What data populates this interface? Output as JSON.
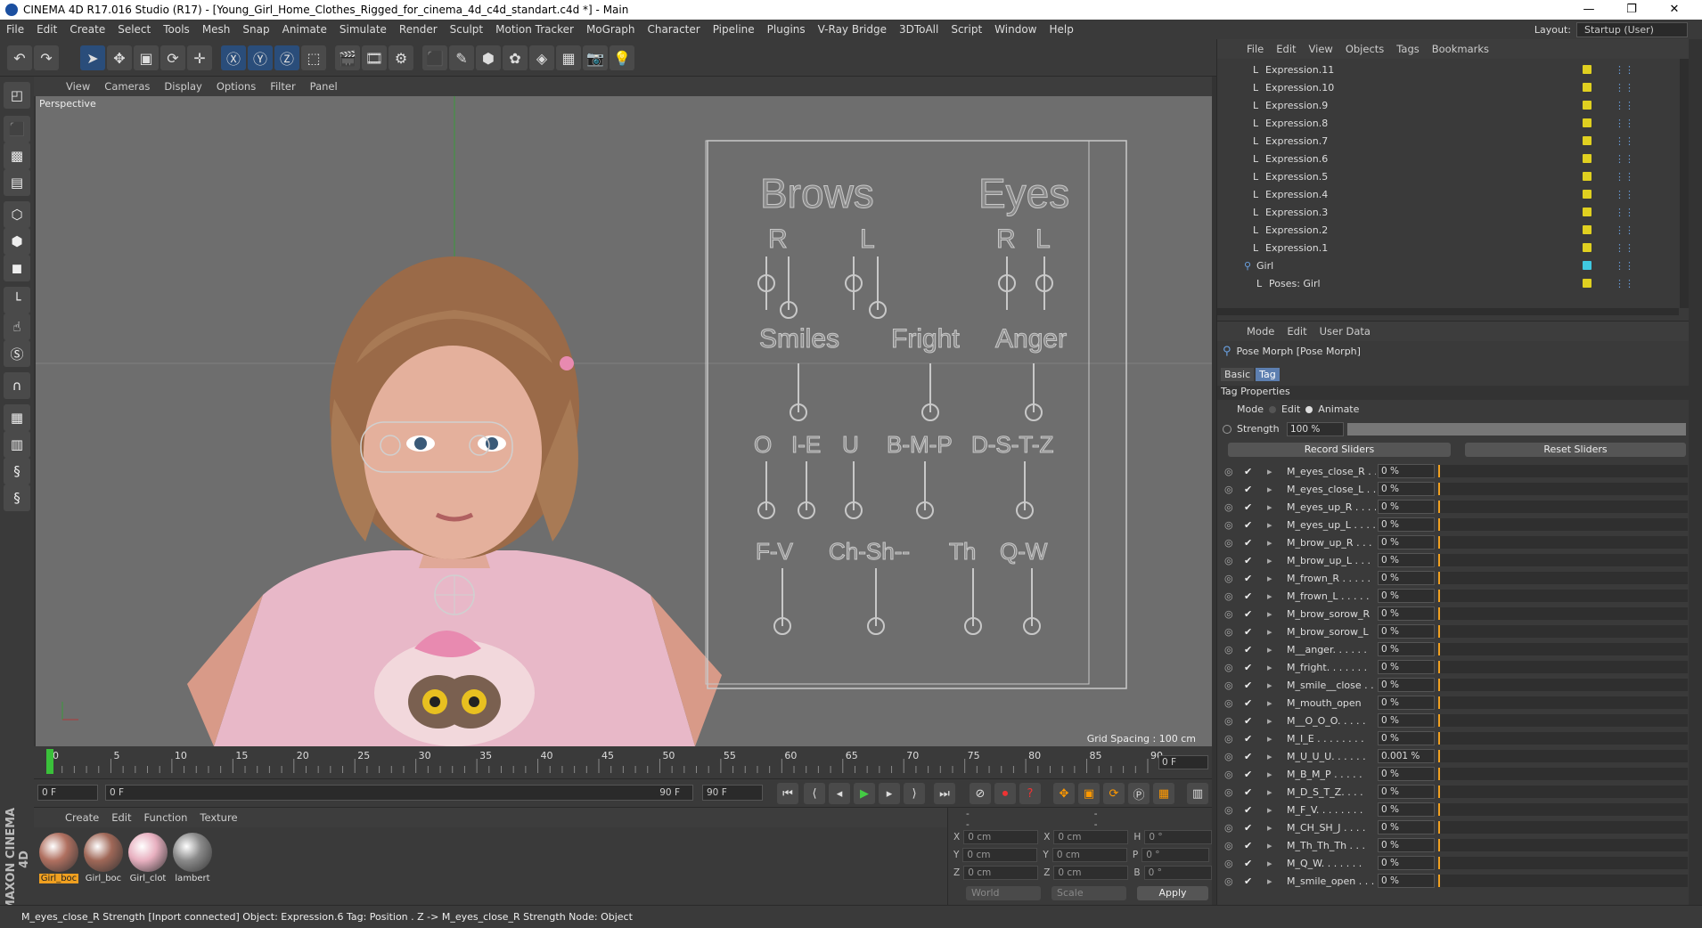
{
  "window": {
    "title": "CINEMA 4D R17.016 Studio (R17) - [Young_Girl_Home_Clothes_Rigged_for_cinema_4d_c4d_standart.c4d *] - Main",
    "min": "—",
    "restore": "❐",
    "close": "✕"
  },
  "menu": [
    "File",
    "Edit",
    "Create",
    "Select",
    "Tools",
    "Mesh",
    "Snap",
    "Animate",
    "Simulate",
    "Render",
    "Sculpt",
    "Motion Tracker",
    "MoGraph",
    "Character",
    "Pipeline",
    "Plugins",
    "V-Ray Bridge",
    "3DToAll",
    "Script",
    "Window",
    "Help"
  ],
  "layout": {
    "label": "Layout:",
    "value": "Startup (User)"
  },
  "viewport": {
    "menu": [
      "View",
      "Cameras",
      "Display",
      "Options",
      "Filter",
      "Panel"
    ],
    "label": "Perspective",
    "grid": "Grid Spacing : 100 cm"
  },
  "rig": {
    "brows": "Brows",
    "eyes": "Eyes",
    "r1": "R",
    "l1": "L",
    "r2": "R",
    "l2": "L",
    "smiles": "Smiles",
    "fright": "Fright",
    "anger": "Anger",
    "o": "O",
    "ie": "I-E",
    "u": "U",
    "bmp": "B-M-P",
    "dstz": "D-S-T-Z",
    "fv": "F-V",
    "chsh": "Ch-Sh--",
    "th": "Th",
    "qw": "Q-W"
  },
  "timeline": {
    "ticks": [
      "0",
      "5",
      "10",
      "15",
      "20",
      "25",
      "30",
      "35",
      "40",
      "45",
      "50",
      "55",
      "60",
      "65",
      "70",
      "75",
      "80",
      "85",
      "90"
    ],
    "frame_end_field": "0 F"
  },
  "transport": {
    "start": "0 F",
    "range_start": "0 F",
    "range_end": "90 F",
    "end": "90 F"
  },
  "materials": {
    "menu": [
      "Create",
      "Edit",
      "Function",
      "Texture"
    ],
    "items": [
      {
        "name": "Girl_boc",
        "color": "#b07060"
      },
      {
        "name": "Girl_boc",
        "color": "#a06858"
      },
      {
        "name": "Girl_clot",
        "color": "#e8b0c0"
      },
      {
        "name": "lambert",
        "color": "#8a8a8a"
      }
    ]
  },
  "coords": {
    "headers": [
      "--",
      "--",
      "--"
    ],
    "x": "0 cm",
    "y": "0 cm",
    "z": "0 cm",
    "sx": "0 cm",
    "sy": "0 cm",
    "sz": "0 cm",
    "h": "0 °",
    "p": "0 °",
    "b": "0 °",
    "world": "World",
    "scale": "Scale",
    "apply": "Apply",
    "lx": "X",
    "ly": "Y",
    "lz": "Z",
    "lsx": "X",
    "lsy": "Y",
    "lsz": "Z",
    "lh": "H",
    "lp": "P",
    "lb": "B"
  },
  "objects": {
    "menu": [
      "File",
      "Edit",
      "View",
      "Objects",
      "Tags",
      "Bookmarks"
    ],
    "rows": [
      "Expression.11",
      "Expression.10",
      "Expression.9",
      "Expression.8",
      "Expression.7",
      "Expression.6",
      "Expression.5",
      "Expression.4",
      "Expression.3",
      "Expression.2",
      "Expression.1",
      "Girl",
      "Poses: Girl"
    ]
  },
  "attributes": {
    "menu": [
      "Mode",
      "Edit",
      "User Data"
    ],
    "title": "Pose Morph [Pose Morph]",
    "tab_basic": "Basic",
    "tab_tag": "Tag",
    "section": "Tag Properties",
    "mode_label": "Mode",
    "mode_edit": "Edit",
    "mode_animate": "Animate",
    "strength_label": "Strength",
    "strength": "100 %",
    "record": "Record Sliders",
    "reset": "Reset Sliders",
    "sliders": [
      {
        "n": "M_eyes_close_R . .",
        "v": "0 %"
      },
      {
        "n": "M_eyes_close_L . .",
        "v": "0 %"
      },
      {
        "n": "M_eyes_up_R . . . .",
        "v": "0 %"
      },
      {
        "n": "M_eyes_up_L . . . .",
        "v": "0 %"
      },
      {
        "n": "M_brow_up_R . . .",
        "v": "0 %"
      },
      {
        "n": "M_brow_up_L . . .",
        "v": "0 %"
      },
      {
        "n": "M_frown_R . . . . .",
        "v": "0 %"
      },
      {
        "n": "M_frown_L . . . . .",
        "v": "0 %"
      },
      {
        "n": "M_brow_sorow_R",
        "v": "0 %"
      },
      {
        "n": "M_brow_sorow_L",
        "v": "0 %"
      },
      {
        "n": "M__anger. . . . . .",
        "v": "0 %"
      },
      {
        "n": "M_fright. . . . . . .",
        "v": "0 %"
      },
      {
        "n": "M_smile__close . .",
        "v": "0 %"
      },
      {
        "n": "M_mouth_open",
        "v": "0 %"
      },
      {
        "n": "M__O_O_O. . . . .",
        "v": "0 %"
      },
      {
        "n": "M_I_E . . . . . . . .",
        "v": "0 %"
      },
      {
        "n": "M_U_U_U. . . . . .",
        "v": "0.001 %"
      },
      {
        "n": "M_B_M_P . . . . .",
        "v": "0 %"
      },
      {
        "n": "M_D_S_T_Z. . . .",
        "v": "0 %"
      },
      {
        "n": "M_F_V. . . . . . . .",
        "v": "0 %"
      },
      {
        "n": "M_CH_SH_J . . . .",
        "v": "0 %"
      },
      {
        "n": "M_Th_Th_Th . . .",
        "v": "0 %"
      },
      {
        "n": "M_Q_W. . . . . . .",
        "v": "0 %"
      },
      {
        "n": "M_smile_open . . .",
        "v": "0 %"
      }
    ]
  },
  "status": "M_eyes_close_R Strength [Inport connected] Object: Expression.6 Tag: Position . Z -> M_eyes_close_R Strength Node: Object",
  "maxon": "MAXON CINEMA 4D"
}
